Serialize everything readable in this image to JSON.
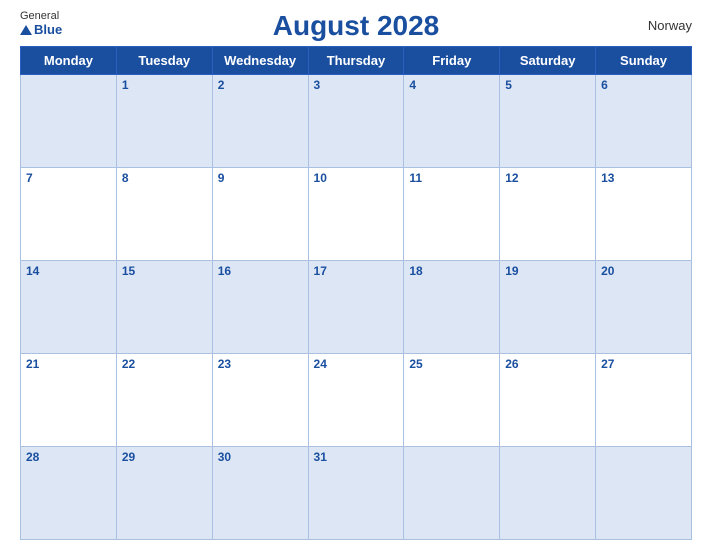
{
  "logo": {
    "general": "General",
    "blue": "Blue"
  },
  "title": "August 2028",
  "country": "Norway",
  "weekdays": [
    "Monday",
    "Tuesday",
    "Wednesday",
    "Thursday",
    "Friday",
    "Saturday",
    "Sunday"
  ],
  "weeks": [
    [
      null,
      1,
      2,
      3,
      4,
      5,
      6
    ],
    [
      7,
      8,
      9,
      10,
      11,
      12,
      13
    ],
    [
      14,
      15,
      16,
      17,
      18,
      19,
      20
    ],
    [
      21,
      22,
      23,
      24,
      25,
      26,
      27
    ],
    [
      28,
      29,
      30,
      31,
      null,
      null,
      null
    ]
  ]
}
